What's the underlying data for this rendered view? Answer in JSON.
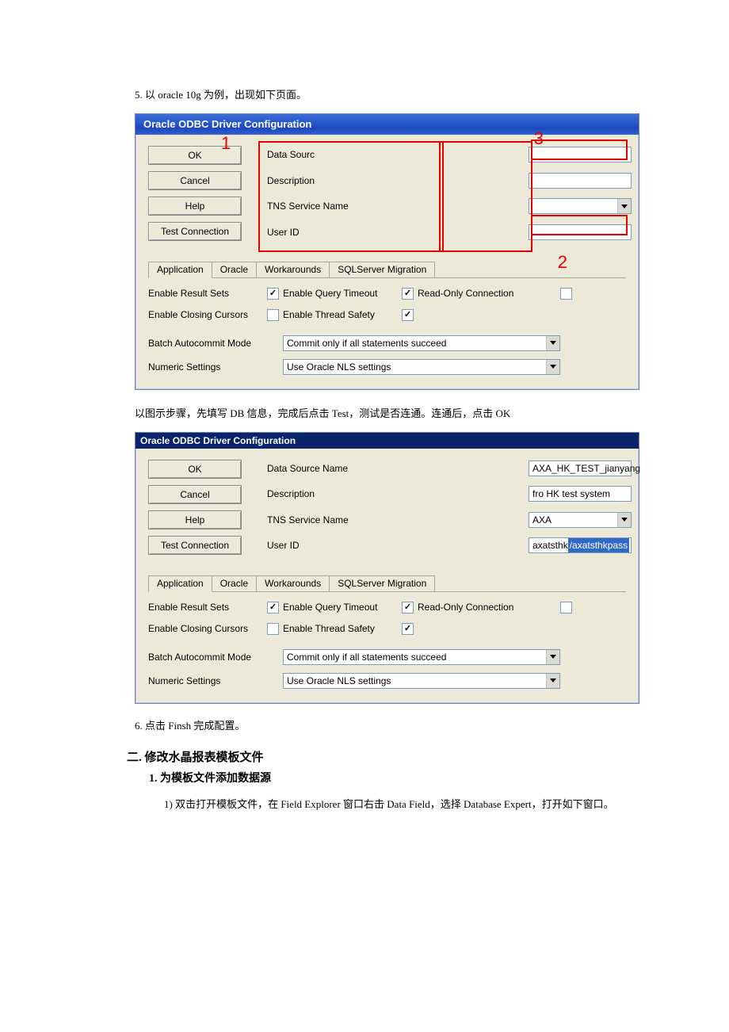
{
  "doc": {
    "step5": "5. 以 oracle 10g 为例，出现如下页面。",
    "instruction_mid": "以图示步骤，先填写 DB 信息，完成后点击 Test，测试是否连通。连通后，点击 OK",
    "step6": "6. 点击 Finsh 完成配置。",
    "section2_title": "二.   修改水晶报表模板文件",
    "section2_1": "1.  为模板文件添加数据源",
    "section2_1_1": "1)  双击打开模板文件，在 Field Explorer 窗口右击 Data Field，选择 Database Expert，打开如下窗口。"
  },
  "annotations": {
    "a1": "1",
    "a2": "2",
    "a3": "3"
  },
  "dialog1": {
    "title": "Oracle ODBC Driver Configuration",
    "labels": {
      "data_source": "Data Sourc",
      "description": "Description",
      "tns": "TNS Service Name",
      "userid": "User ID"
    },
    "values": {
      "data_source": "",
      "description": "",
      "tns": "",
      "userid": ""
    },
    "buttons": {
      "ok": "OK",
      "cancel": "Cancel",
      "help": "Help",
      "test": "Test Connection"
    },
    "tabs": {
      "application": "Application",
      "oracle": "Oracle",
      "workarounds": "Workarounds",
      "sqlserver": "SQLServer Migration"
    },
    "checks": {
      "enable_result_sets": "Enable Result Sets",
      "enable_query_timeout": "Enable Query Timeout",
      "read_only": "Read-Only Connection",
      "enable_closing_cursors": "Enable Closing Cursors",
      "enable_thread_safety": "Enable Thread Safety"
    },
    "options": {
      "batch_label": "Batch Autocommit Mode",
      "batch_value": "Commit only if all statements succeed",
      "numeric_label": "Numeric Settings",
      "numeric_value": "Use Oracle NLS settings"
    }
  },
  "dialog2": {
    "title": "Oracle ODBC Driver Configuration",
    "labels": {
      "data_source": "Data Source Name",
      "description": "Description",
      "tns": "TNS Service Name",
      "userid": "User ID"
    },
    "values": {
      "data_source": "AXA_HK_TEST_jianyang",
      "description": "fro HK test system",
      "tns": "AXA",
      "userid_plain": "axatsthk",
      "userid_sel": "/axatsthkpass"
    },
    "buttons": {
      "ok": "OK",
      "cancel": "Cancel",
      "help": "Help",
      "test": "Test Connection"
    },
    "tabs": {
      "application": "Application",
      "oracle": "Oracle",
      "workarounds": "Workarounds",
      "sqlserver": "SQLServer Migration"
    },
    "checks": {
      "enable_result_sets": "Enable Result Sets",
      "enable_query_timeout": "Enable Query Timeout",
      "read_only": "Read-Only Connection",
      "enable_closing_cursors": "Enable Closing Cursors",
      "enable_thread_safety": "Enable Thread Safety"
    },
    "options": {
      "batch_label": "Batch Autocommit Mode",
      "batch_value": "Commit only if all statements succeed",
      "numeric_label": "Numeric Settings",
      "numeric_value": "Use Oracle NLS settings"
    }
  }
}
